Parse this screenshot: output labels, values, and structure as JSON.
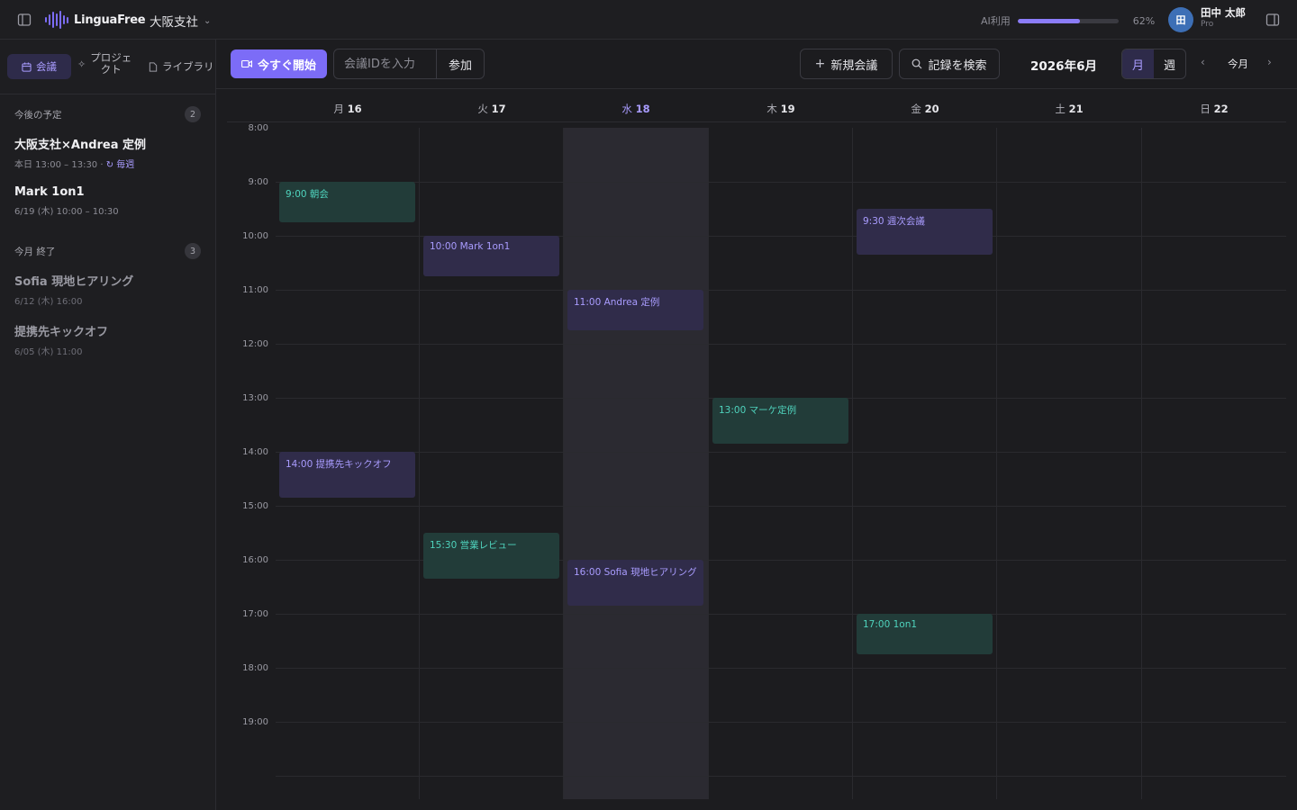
{
  "topbar": {
    "app_name": "LinguaFree",
    "org": "大阪支社",
    "ai_label": "AI利用",
    "ai_percent_text": "62%",
    "ai_usage_fraction": 0.62,
    "avatar_initial": "田",
    "user_name": "田中 太郎",
    "user_plan": "Pro",
    "accent_color": "#7c6cf7"
  },
  "sidebar": {
    "tabs": [
      {
        "label": "会議",
        "icon": "calendar-icon"
      },
      {
        "label": "プロジェクト",
        "icon": "sparkle-icon"
      },
      {
        "label": "ライブラリ",
        "icon": "file-icon"
      }
    ],
    "upcoming": {
      "heading": "今後の予定",
      "count": "2",
      "items": [
        {
          "title": "大阪支社×Andrea 定例",
          "subtitle": "本日 13:00 – 13:30 ·",
          "repeat": "↻ 毎週"
        },
        {
          "title": "Mark 1on1",
          "subtitle": "6/19 (木) 10:00 – 10:30"
        }
      ]
    },
    "done": {
      "heading": "今月 終了",
      "count": "3",
      "items": [
        {
          "title": "Sofia 現地ヒアリング",
          "subtitle": "6/12 (木) 16:00"
        },
        {
          "title": "提携先キックオフ",
          "subtitle": "6/05 (木) 11:00"
        }
      ]
    }
  },
  "toolbar": {
    "start_now": "今すぐ開始",
    "meeting_id_placeholder": "会議IDを入力",
    "join": "参加",
    "new_meeting": "新規会議",
    "search_records": "記録を検索",
    "month_label": "2026年6月",
    "view_month": "月",
    "view_week": "週",
    "today": "今月"
  },
  "calendar": {
    "days": [
      {
        "dow": "月",
        "date": "16"
      },
      {
        "dow": "火",
        "date": "17"
      },
      {
        "dow": "水",
        "date": "18"
      },
      {
        "dow": "木",
        "date": "19"
      },
      {
        "dow": "金",
        "date": "20"
      },
      {
        "dow": "土",
        "date": "21"
      },
      {
        "dow": "日",
        "date": "22"
      }
    ],
    "hours": [
      "8:00",
      "9:00",
      "10:00",
      "11:00",
      "12:00",
      "13:00",
      "14:00",
      "15:00",
      "16:00",
      "17:00",
      "18:00",
      "19:00"
    ],
    "events": [
      {
        "label": "9:00 朝会",
        "day": 0,
        "start": 9.0,
        "end": 9.75,
        "color": "teal"
      },
      {
        "label": "14:00 提携先キックオフ",
        "day": 0,
        "start": 14.0,
        "end": 14.85,
        "color": "purple"
      },
      {
        "label": "10:00 Mark 1on1",
        "day": 1,
        "start": 10.0,
        "end": 10.75,
        "color": "purple"
      },
      {
        "label": "15:30 営業レビュー",
        "day": 1,
        "start": 15.5,
        "end": 16.35,
        "color": "teal"
      },
      {
        "label": "11:00 Andrea 定例",
        "day": 2,
        "start": 11.0,
        "end": 11.75,
        "color": "purple"
      },
      {
        "label": "16:00 Sofia 現地ヒアリング",
        "day": 2,
        "start": 16.0,
        "end": 16.85,
        "color": "purple"
      },
      {
        "label": "13:00 マーケ定例",
        "day": 3,
        "start": 13.0,
        "end": 13.85,
        "color": "teal"
      },
      {
        "label": "9:30 週次会議",
        "day": 4,
        "start": 9.5,
        "end": 10.35,
        "color": "purple"
      },
      {
        "label": "17:00 1on1",
        "day": 4,
        "start": 17.0,
        "end": 17.75,
        "color": "teal"
      }
    ],
    "today_index": 2
  }
}
